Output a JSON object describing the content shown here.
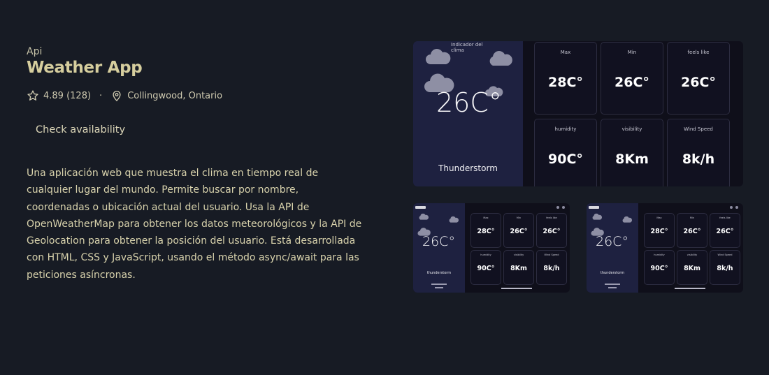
{
  "project": {
    "category": "Api",
    "title": "Weather App",
    "rating": "4.89 (128)",
    "separator": "·",
    "location": "Collingwood, Ontario",
    "check_label": "Check availability",
    "description": "Una aplicación web que muestra el clima en tiempo real de cualquier lugar del mundo. Permite buscar por nombre, coordenadas o ubicación actual del usuario. Usa la API de OpenWeatherMap para obtener los datos meteorológicos y la API de Geolocation para obtener la posición del usuario. Está desarrollada con HTML, CSS y JavaScript, usando el método async/await para las peticiones asíncronas."
  },
  "preview": {
    "broken_image_alt": "Indicador del clima",
    "temperature": "26C°",
    "condition": "Thunderstorm",
    "cards": [
      {
        "label": "Max",
        "value": "28C°"
      },
      {
        "label": "Min",
        "value": "26C°"
      },
      {
        "label": "feels like",
        "value": "26C°"
      },
      {
        "label": "humidity",
        "value": "90C°"
      },
      {
        "label": "visibility",
        "value": "8Km"
      },
      {
        "label": "Wind Speed",
        "value": "8k/h"
      }
    ],
    "small_condition": "thunderstorm"
  },
  "colors": {
    "background": "#171b24",
    "title": "#d6ce9e",
    "text": "#d8d2ac",
    "panel": "#1e2140",
    "cards": "#111120"
  },
  "icons": [
    "star-icon",
    "location-pin-icon",
    "cloud-icon"
  ]
}
